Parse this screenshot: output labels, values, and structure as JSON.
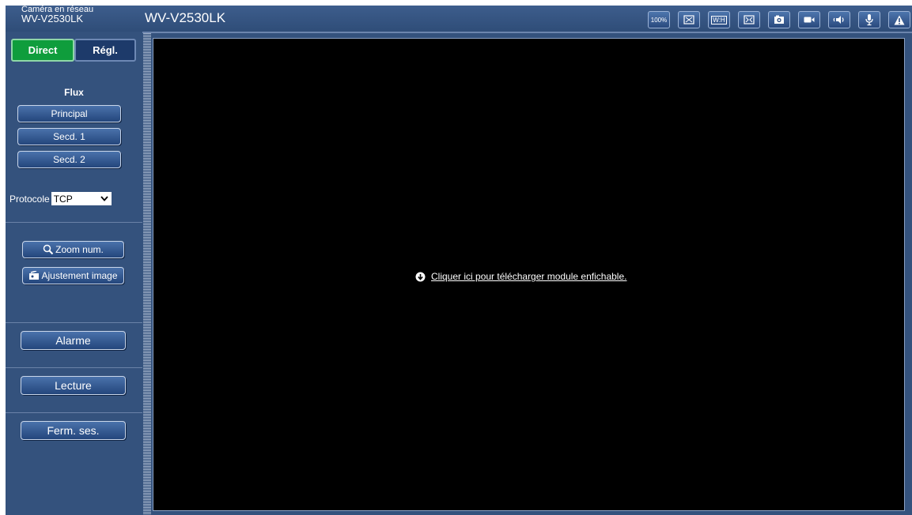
{
  "header": {
    "brand_line1": "Caméra en réseau",
    "brand_line2": "WV-V2530LK",
    "model": "WV-V2530LK",
    "toolbar": [
      {
        "name": "zoom-100-button",
        "icon": "text-100",
        "label": "100%"
      },
      {
        "name": "fit-screen-button",
        "icon": "fit-screen-icon"
      },
      {
        "name": "wh-button",
        "icon": "wh-icon",
        "label": "W:H"
      },
      {
        "name": "fullscreen-button",
        "icon": "fullscreen-icon"
      },
      {
        "name": "snapshot-button",
        "icon": "camera-icon"
      },
      {
        "name": "record-button",
        "icon": "video-camera-icon"
      },
      {
        "name": "speaker-button",
        "icon": "speaker-icon"
      },
      {
        "name": "microphone-button",
        "icon": "microphone-icon"
      },
      {
        "name": "alarm-status-button",
        "icon": "warning-icon"
      }
    ]
  },
  "sidebar": {
    "tabs": {
      "live": "Direct",
      "setup": "Régl."
    },
    "flux_label": "Flux",
    "streams": [
      "Principal",
      "Secd. 1",
      "Secd. 2"
    ],
    "protocol": {
      "label": "Protocole",
      "value": "TCP"
    },
    "digital_zoom": "Zoom num.",
    "image_adjust": "Ajustement image",
    "alarm": "Alarme",
    "playback": "Lecture",
    "logout": "Ferm. ses."
  },
  "viewer": {
    "plugin_link": "Cliquer ici pour télécharger module enfichable."
  },
  "colors": {
    "background": "#34527d",
    "live_tab": "#0f9d3c",
    "viewer": "#000000"
  }
}
